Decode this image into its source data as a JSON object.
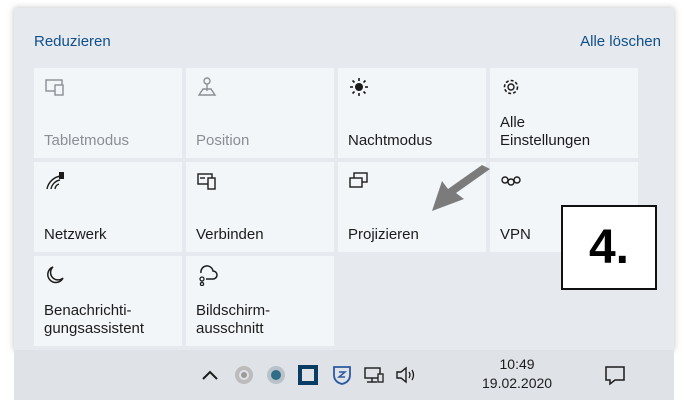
{
  "header": {
    "collapse_label": "Reduzieren",
    "clear_all_label": "Alle löschen"
  },
  "tiles": [
    {
      "label": "Tabletmodus",
      "icon": "tablet-mode-icon",
      "enabled": false
    },
    {
      "label": "Position",
      "icon": "location-icon",
      "enabled": false
    },
    {
      "label": "Nachtmodus",
      "icon": "night-light-icon",
      "enabled": true
    },
    {
      "label": "Alle\nEinstellungen",
      "icon": "gear-icon",
      "enabled": true
    },
    {
      "label": "Netzwerk",
      "icon": "network-icon",
      "enabled": true
    },
    {
      "label": "Verbinden",
      "icon": "connect-icon",
      "enabled": true
    },
    {
      "label": "Projizieren",
      "icon": "project-icon",
      "enabled": true
    },
    {
      "label": "VPN",
      "icon": "vpn-icon",
      "enabled": true
    },
    {
      "label": "Benachrichti-\ngungsassistent",
      "icon": "focus-assist-icon",
      "enabled": true
    },
    {
      "label": "Bildschirm-\nausschnitt",
      "icon": "snip-icon",
      "enabled": true
    }
  ],
  "callout": {
    "text": "4."
  },
  "taskbar": {
    "time": "10:49",
    "date": "19.02.2020",
    "icons": [
      "chevron-up-icon",
      "app-icon-1",
      "app-icon-2",
      "app-icon-3",
      "shield-icon",
      "network-icon",
      "volume-icon",
      "notification-icon"
    ]
  },
  "colors": {
    "panel": "#e6eaef",
    "tile": "#f3f6f9",
    "link": "#0f4f8a",
    "taskbar": "#dfe3e8"
  }
}
